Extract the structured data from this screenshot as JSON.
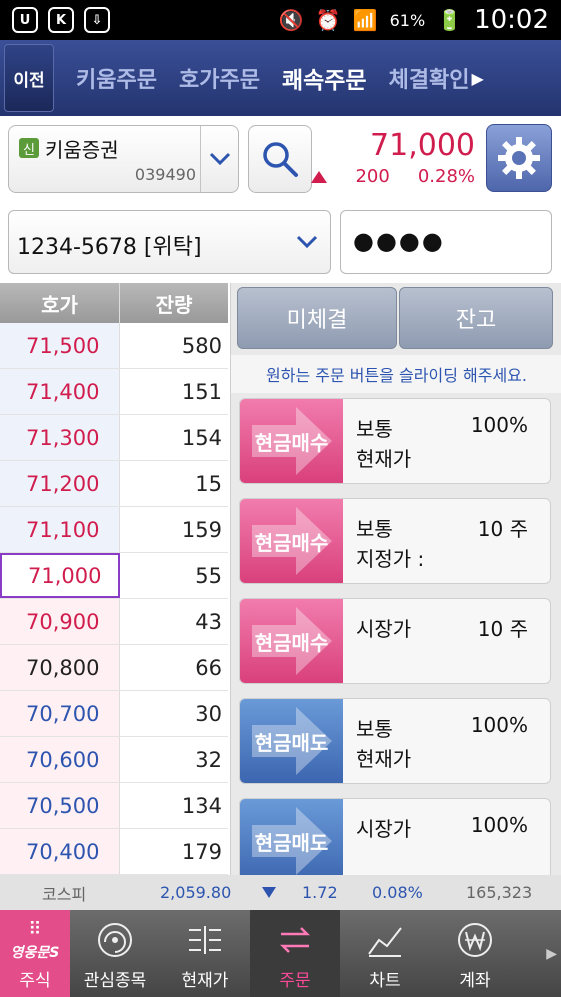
{
  "status_bar": {
    "battery": "61%",
    "time": "10:02"
  },
  "top_tabs": {
    "back_label": "이전",
    "tabs": [
      {
        "label": "키움주문"
      },
      {
        "label": "호가주문"
      },
      {
        "label": "쾌속주문"
      },
      {
        "label": "체결확인"
      }
    ],
    "active_tab": "쾌속주문"
  },
  "stock": {
    "badge": "신",
    "name": "키움증권",
    "code": "039490",
    "price": "71,000",
    "change": "200",
    "change_pct": "0.28%",
    "price_color": "#d11d4e"
  },
  "account": {
    "number": "1234-5678 [위탁]",
    "password_mask": "●●●●"
  },
  "order_book": {
    "headers": {
      "price": "호가",
      "qty": "잔량"
    },
    "rows": [
      {
        "price": "71,500",
        "qty": "580",
        "color": "#d11d4e",
        "kind": "ask"
      },
      {
        "price": "71,400",
        "qty": "151",
        "color": "#d11d4e",
        "kind": "ask"
      },
      {
        "price": "71,300",
        "qty": "154",
        "color": "#d11d4e",
        "kind": "ask"
      },
      {
        "price": "71,200",
        "qty": "15",
        "color": "#d11d4e",
        "kind": "ask"
      },
      {
        "price": "71,100",
        "qty": "159",
        "color": "#d11d4e",
        "kind": "ask"
      },
      {
        "price": "71,000",
        "qty": "55",
        "color": "#d11d4e",
        "kind": "selected"
      },
      {
        "price": "70,900",
        "qty": "43",
        "color": "#d11d4e",
        "kind": "bid"
      },
      {
        "price": "70,800",
        "qty": "66",
        "color": "#222222",
        "kind": "bid"
      },
      {
        "price": "70,700",
        "qty": "30",
        "color": "#2d55b0",
        "kind": "bid"
      },
      {
        "price": "70,600",
        "qty": "32",
        "color": "#2d55b0",
        "kind": "bid"
      },
      {
        "price": "70,500",
        "qty": "134",
        "color": "#2d55b0",
        "kind": "bid"
      },
      {
        "price": "70,400",
        "qty": "179",
        "color": "#2d55b0",
        "kind": "bid"
      }
    ]
  },
  "panel": {
    "unfilled_label": "미체결",
    "balance_label": "잔고",
    "hint": "원하는 주문 버튼을 슬라이딩 해주세요.",
    "orders": [
      {
        "side": "buy",
        "label": "현금매수",
        "type": "보통",
        "type2": "현재가",
        "value": "100%"
      },
      {
        "side": "buy",
        "label": "현금매수",
        "type": "보통",
        "type2": "지정가 :",
        "value": "10 주"
      },
      {
        "side": "buy",
        "label": "현금매수",
        "type": "시장가",
        "type2": "",
        "value": "10 주"
      },
      {
        "side": "sell",
        "label": "현금매도",
        "type": "보통",
        "type2": "현재가",
        "value": "100%"
      },
      {
        "side": "sell",
        "label": "현금매도",
        "type": "시장가",
        "type2": "",
        "value": "100%"
      }
    ]
  },
  "ticker": {
    "name": "코스피",
    "value": "2,059.80",
    "change": "1.72",
    "change_pct": "0.08%",
    "volume": "165,323"
  },
  "bottom_nav": {
    "home_logo": "영웅문S",
    "items": [
      {
        "label": "주식"
      },
      {
        "label": "관심종목"
      },
      {
        "label": "현재가"
      },
      {
        "label": "주문"
      },
      {
        "label": "차트"
      },
      {
        "label": "계좌"
      }
    ]
  }
}
